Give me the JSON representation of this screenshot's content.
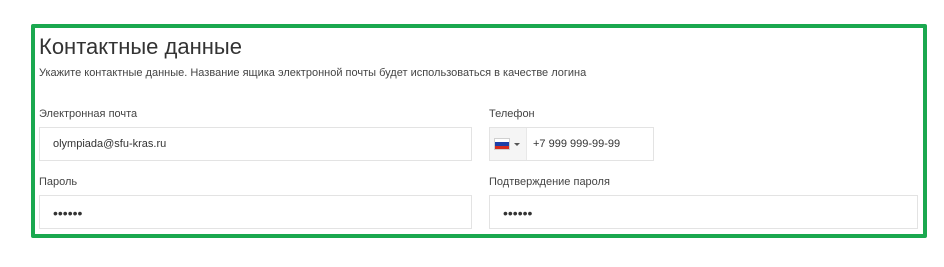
{
  "section": {
    "title": "Контактные данные",
    "subtitle": "Укажите контактные данные. Название ящика электронной почты будет использоваться в качестве логина"
  },
  "fields": {
    "email": {
      "label": "Электронная почта",
      "value": "olympiada@sfu-kras.ru"
    },
    "phone": {
      "label": "Телефон",
      "value": "+7 999 999-99-99",
      "country_icon": "russia-flag-icon"
    },
    "password": {
      "label": "Пароль",
      "value": "••••••"
    },
    "password_confirm": {
      "label": "Подтверждение пароля",
      "value": "••••••"
    }
  },
  "colors": {
    "highlight_border": "#1aa84f",
    "flag_white": "#ffffff",
    "flag_blue": "#1c3fa8",
    "flag_red": "#d52b1e"
  }
}
